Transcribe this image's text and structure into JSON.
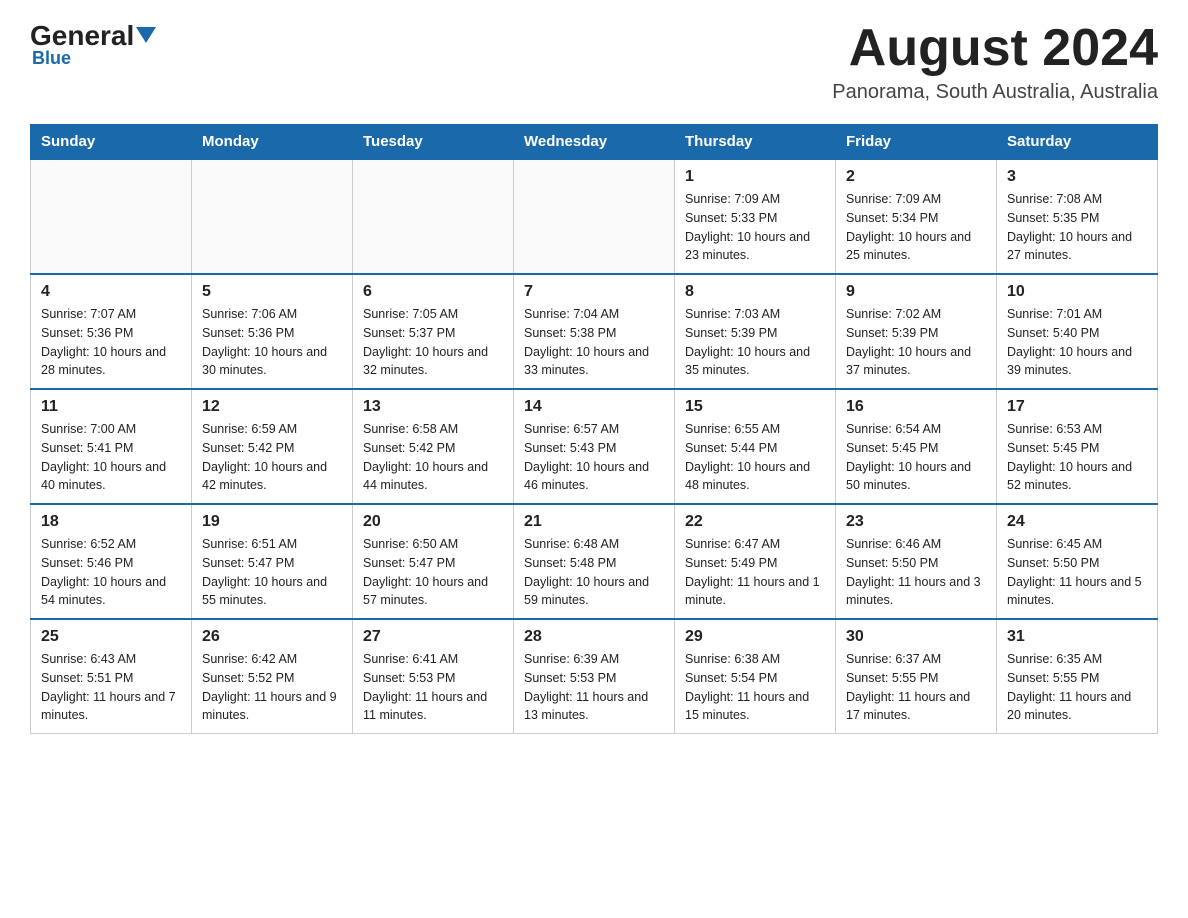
{
  "header": {
    "logo": {
      "general": "General",
      "blue": "Blue"
    },
    "title": "August 2024",
    "location": "Panorama, South Australia, Australia"
  },
  "days_of_week": [
    "Sunday",
    "Monday",
    "Tuesday",
    "Wednesday",
    "Thursday",
    "Friday",
    "Saturday"
  ],
  "weeks": [
    [
      {
        "day": "",
        "info": ""
      },
      {
        "day": "",
        "info": ""
      },
      {
        "day": "",
        "info": ""
      },
      {
        "day": "",
        "info": ""
      },
      {
        "day": "1",
        "info": "Sunrise: 7:09 AM\nSunset: 5:33 PM\nDaylight: 10 hours and 23 minutes."
      },
      {
        "day": "2",
        "info": "Sunrise: 7:09 AM\nSunset: 5:34 PM\nDaylight: 10 hours and 25 minutes."
      },
      {
        "day": "3",
        "info": "Sunrise: 7:08 AM\nSunset: 5:35 PM\nDaylight: 10 hours and 27 minutes."
      }
    ],
    [
      {
        "day": "4",
        "info": "Sunrise: 7:07 AM\nSunset: 5:36 PM\nDaylight: 10 hours and 28 minutes."
      },
      {
        "day": "5",
        "info": "Sunrise: 7:06 AM\nSunset: 5:36 PM\nDaylight: 10 hours and 30 minutes."
      },
      {
        "day": "6",
        "info": "Sunrise: 7:05 AM\nSunset: 5:37 PM\nDaylight: 10 hours and 32 minutes."
      },
      {
        "day": "7",
        "info": "Sunrise: 7:04 AM\nSunset: 5:38 PM\nDaylight: 10 hours and 33 minutes."
      },
      {
        "day": "8",
        "info": "Sunrise: 7:03 AM\nSunset: 5:39 PM\nDaylight: 10 hours and 35 minutes."
      },
      {
        "day": "9",
        "info": "Sunrise: 7:02 AM\nSunset: 5:39 PM\nDaylight: 10 hours and 37 minutes."
      },
      {
        "day": "10",
        "info": "Sunrise: 7:01 AM\nSunset: 5:40 PM\nDaylight: 10 hours and 39 minutes."
      }
    ],
    [
      {
        "day": "11",
        "info": "Sunrise: 7:00 AM\nSunset: 5:41 PM\nDaylight: 10 hours and 40 minutes."
      },
      {
        "day": "12",
        "info": "Sunrise: 6:59 AM\nSunset: 5:42 PM\nDaylight: 10 hours and 42 minutes."
      },
      {
        "day": "13",
        "info": "Sunrise: 6:58 AM\nSunset: 5:42 PM\nDaylight: 10 hours and 44 minutes."
      },
      {
        "day": "14",
        "info": "Sunrise: 6:57 AM\nSunset: 5:43 PM\nDaylight: 10 hours and 46 minutes."
      },
      {
        "day": "15",
        "info": "Sunrise: 6:55 AM\nSunset: 5:44 PM\nDaylight: 10 hours and 48 minutes."
      },
      {
        "day": "16",
        "info": "Sunrise: 6:54 AM\nSunset: 5:45 PM\nDaylight: 10 hours and 50 minutes."
      },
      {
        "day": "17",
        "info": "Sunrise: 6:53 AM\nSunset: 5:45 PM\nDaylight: 10 hours and 52 minutes."
      }
    ],
    [
      {
        "day": "18",
        "info": "Sunrise: 6:52 AM\nSunset: 5:46 PM\nDaylight: 10 hours and 54 minutes."
      },
      {
        "day": "19",
        "info": "Sunrise: 6:51 AM\nSunset: 5:47 PM\nDaylight: 10 hours and 55 minutes."
      },
      {
        "day": "20",
        "info": "Sunrise: 6:50 AM\nSunset: 5:47 PM\nDaylight: 10 hours and 57 minutes."
      },
      {
        "day": "21",
        "info": "Sunrise: 6:48 AM\nSunset: 5:48 PM\nDaylight: 10 hours and 59 minutes."
      },
      {
        "day": "22",
        "info": "Sunrise: 6:47 AM\nSunset: 5:49 PM\nDaylight: 11 hours and 1 minute."
      },
      {
        "day": "23",
        "info": "Sunrise: 6:46 AM\nSunset: 5:50 PM\nDaylight: 11 hours and 3 minutes."
      },
      {
        "day": "24",
        "info": "Sunrise: 6:45 AM\nSunset: 5:50 PM\nDaylight: 11 hours and 5 minutes."
      }
    ],
    [
      {
        "day": "25",
        "info": "Sunrise: 6:43 AM\nSunset: 5:51 PM\nDaylight: 11 hours and 7 minutes."
      },
      {
        "day": "26",
        "info": "Sunrise: 6:42 AM\nSunset: 5:52 PM\nDaylight: 11 hours and 9 minutes."
      },
      {
        "day": "27",
        "info": "Sunrise: 6:41 AM\nSunset: 5:53 PM\nDaylight: 11 hours and 11 minutes."
      },
      {
        "day": "28",
        "info": "Sunrise: 6:39 AM\nSunset: 5:53 PM\nDaylight: 11 hours and 13 minutes."
      },
      {
        "day": "29",
        "info": "Sunrise: 6:38 AM\nSunset: 5:54 PM\nDaylight: 11 hours and 15 minutes."
      },
      {
        "day": "30",
        "info": "Sunrise: 6:37 AM\nSunset: 5:55 PM\nDaylight: 11 hours and 17 minutes."
      },
      {
        "day": "31",
        "info": "Sunrise: 6:35 AM\nSunset: 5:55 PM\nDaylight: 11 hours and 20 minutes."
      }
    ]
  ]
}
